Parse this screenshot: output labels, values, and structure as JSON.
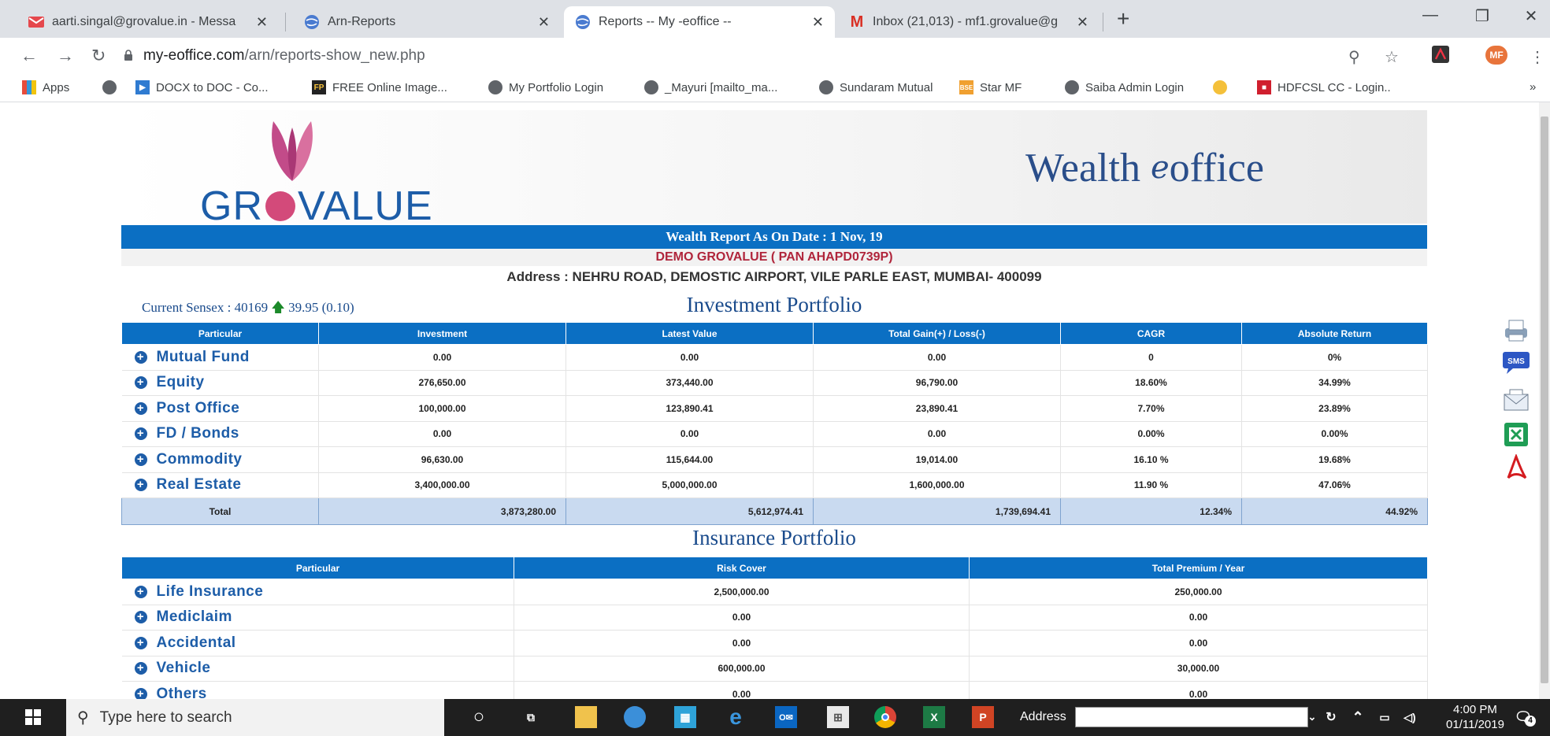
{
  "browser": {
    "tabs": [
      {
        "title": "aarti.singal@grovalue.in - Messa",
        "icon": "mail-icon"
      },
      {
        "title": "Arn-Reports",
        "icon": "globe-icon"
      },
      {
        "title": "Reports -- My -eoffice --",
        "icon": "globe-icon"
      },
      {
        "title": "Inbox (21,013) - mf1.grovalue@g",
        "icon": "gmail-icon"
      }
    ],
    "url_domain": "my-eoffice.com",
    "url_path": "/arn/reports-show_new.php",
    "profile": "MF",
    "bookmarks": [
      {
        "label": "Apps"
      },
      {
        "label": "DOCX to DOC - Co..."
      },
      {
        "label": "FREE Online Image..."
      },
      {
        "label": "My Portfolio Login"
      },
      {
        "label": "_Mayuri [mailto_ma..."
      },
      {
        "label": "Sundaram Mutual"
      },
      {
        "label": "Star MF"
      },
      {
        "label": "Saiba Admin Login"
      },
      {
        "label": "HDFCSL CC - Login.."
      }
    ],
    "more_bookmarks": "»",
    "colors": {
      "accent": "#0b6fc3",
      "brand": "#1d5da8",
      "name": "#b0253b"
    }
  },
  "report": {
    "logo_pre": "GR",
    "logo_post": "VALUE",
    "brand_pre": "Wealth ",
    "brand_post": "office",
    "title": "Wealth Report As On Date : 1 Nov, 19",
    "client": "DEMO GROVALUE ( PAN AHAPD0739P)",
    "address": "Address : NEHRU ROAD, DEMOSTIC AIRPORT, VILE PARLE EAST, MUMBAI- 400099",
    "sensex_label": "Current Sensex : 40169",
    "sensex_change": "39.95 (0.10)",
    "investment_title": "Investment Portfolio",
    "investment_headers": [
      "Particular",
      "Investment",
      "Latest Value",
      "Total Gain(+) / Loss(-)",
      "CAGR",
      "Absolute Return"
    ],
    "investment_rows": [
      {
        "name": "Mutual Fund",
        "inv": "0.00",
        "latest": "0.00",
        "gain": "0.00",
        "cagr": "0",
        "abs": "0%"
      },
      {
        "name": "Equity",
        "inv": "276,650.00",
        "latest": "373,440.00",
        "gain": "96,790.00",
        "cagr": "18.60%",
        "abs": "34.99%"
      },
      {
        "name": "Post Office",
        "inv": "100,000.00",
        "latest": "123,890.41",
        "gain": "23,890.41",
        "cagr": "7.70%",
        "abs": "23.89%"
      },
      {
        "name": "FD / Bonds",
        "inv": "0.00",
        "latest": "0.00",
        "gain": "0.00",
        "cagr": "0.00%",
        "abs": "0.00%"
      },
      {
        "name": "Commodity",
        "inv": "96,630.00",
        "latest": "115,644.00",
        "gain": "19,014.00",
        "cagr": "16.10 %",
        "abs": "19.68%"
      },
      {
        "name": "Real Estate",
        "inv": "3,400,000.00",
        "latest": "5,000,000.00",
        "gain": "1,600,000.00",
        "cagr": "11.90 %",
        "abs": "47.06%"
      }
    ],
    "investment_total": {
      "label": "Total",
      "inv": "3,873,280.00",
      "latest": "5,612,974.41",
      "gain": "1,739,694.41",
      "cagr": "12.34%",
      "abs": "44.92%"
    },
    "insurance_title": "Insurance Portfolio",
    "insurance_headers": [
      "Particular",
      "Risk Cover",
      "Total Premium / Year"
    ],
    "insurance_rows": [
      {
        "name": "Life Insurance",
        "cover": "2,500,000.00",
        "premium": "250,000.00"
      },
      {
        "name": "Mediclaim",
        "cover": "0.00",
        "premium": "0.00"
      },
      {
        "name": "Accidental",
        "cover": "0.00",
        "premium": "0.00"
      },
      {
        "name": "Vehicle",
        "cover": "600,000.00",
        "premium": "30,000.00"
      },
      {
        "name": "Others",
        "cover": "0.00",
        "premium": "0.00"
      }
    ],
    "side_icons": [
      "print-icon",
      "sms-icon",
      "email-icon",
      "excel-icon",
      "pdf-icon"
    ],
    "sms_label": "SMS"
  },
  "taskbar": {
    "search_placeholder": "Type here to search",
    "address_label": "Address",
    "time": "4:00 PM",
    "date": "01/11/2019",
    "notification_count": "4"
  }
}
